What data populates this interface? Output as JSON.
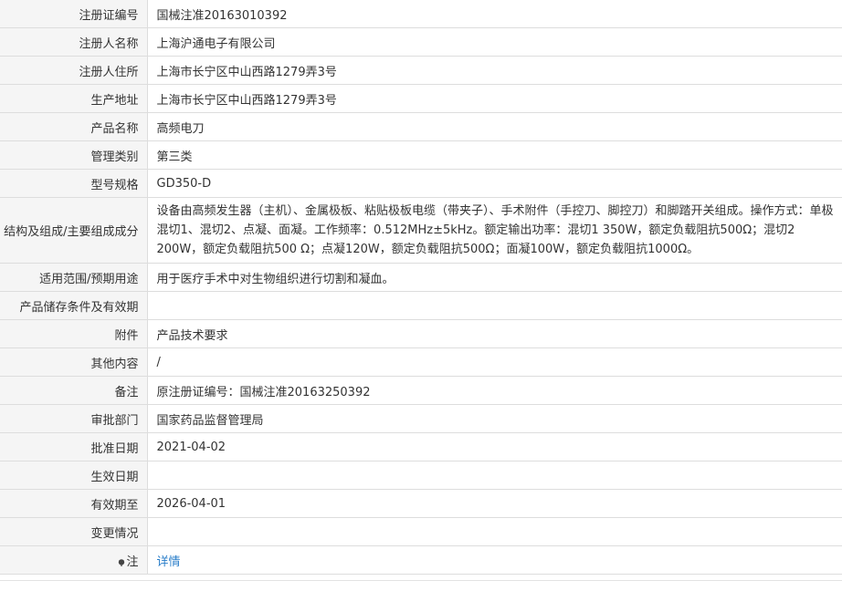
{
  "rows": [
    {
      "label": "注册证编号",
      "value": "国械注准20163010392"
    },
    {
      "label": "注册人名称",
      "value": "上海沪通电子有限公司"
    },
    {
      "label": "注册人住所",
      "value": "上海市长宁区中山西路1279弄3号"
    },
    {
      "label": "生产地址",
      "value": "上海市长宁区中山西路1279弄3号"
    },
    {
      "label": "产品名称",
      "value": "高频电刀"
    },
    {
      "label": "管理类别",
      "value": "第三类"
    },
    {
      "label": "型号规格",
      "value": "GD350-D"
    },
    {
      "label": "结构及组成/主要组成成分",
      "value": "设备由高频发生器（主机）、金属极板、粘贴极板电缆（带夹子）、手术附件（手控刀、脚控刀）和脚踏开关组成。操作方式：单极混切1、混切2、点凝、面凝。工作频率：0.512MHz±5kHz。额定输出功率：混切1 350W，额定负载阻抗500Ω；混切2 200W，额定负载阻抗500 Ω；点凝120W，额定负载阻抗500Ω；面凝100W，额定负载阻抗1000Ω。"
    },
    {
      "label": "适用范围/预期用途",
      "value": "用于医疗手术中对生物组织进行切割和凝血。"
    },
    {
      "label": "产品储存条件及有效期",
      "value": ""
    },
    {
      "label": "附件",
      "value": "产品技术要求"
    },
    {
      "label": "其他内容",
      "value": "/"
    },
    {
      "label": "备注",
      "value": "原注册证编号：国械注准20163250392"
    },
    {
      "label": "审批部门",
      "value": "国家药品监督管理局"
    },
    {
      "label": "批准日期",
      "value": "2021-04-02"
    },
    {
      "label": "生效日期",
      "value": ""
    },
    {
      "label": "有效期至",
      "value": "2026-04-01"
    },
    {
      "label": "变更情况",
      "value": ""
    },
    {
      "label": "注",
      "value": "详情",
      "icon": "pin-icon"
    }
  ],
  "colors": {
    "label_bg": "#f5f5f5",
    "border": "#dddddd",
    "link": "#2a7ec9",
    "text": "#333333"
  }
}
